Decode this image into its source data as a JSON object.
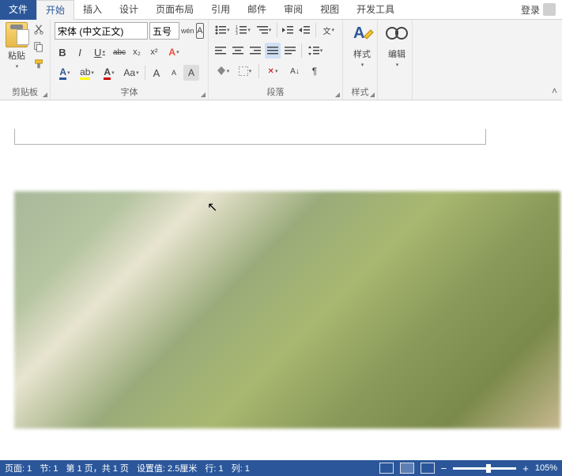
{
  "tabs": {
    "file": "文件",
    "home": "开始",
    "insert": "插入",
    "design": "设计",
    "layout": "页面布局",
    "references": "引用",
    "mail": "邮件",
    "review": "审阅",
    "view": "视图",
    "dev": "开发工具"
  },
  "login": "登录",
  "groups": {
    "clipboard": "剪贴板",
    "font": "字体",
    "paragraph": "段落",
    "styles": "样式",
    "editing": "编辑"
  },
  "clipboard": {
    "paste": "粘贴"
  },
  "font": {
    "name": "宋体 (中文正文)",
    "size": "五号",
    "phonetic": "wén",
    "char_border": "A",
    "bold": "B",
    "italic": "I",
    "underline": "U",
    "strike": "abc",
    "sub": "x₂",
    "sup": "x²",
    "char_a": "A",
    "aa": "Aa",
    "grow": "A",
    "shrink": "A",
    "char_shade": "A"
  },
  "styles": {
    "label": "样式"
  },
  "editing": {
    "label": "编辑"
  },
  "status": {
    "page": "页面: 1",
    "section": "节: 1",
    "page_of": "第 1 页，共 1 页",
    "pos": "设置值: 2.5厘米",
    "line": "行: 1",
    "col": "列: 1",
    "zoom": "105%"
  }
}
